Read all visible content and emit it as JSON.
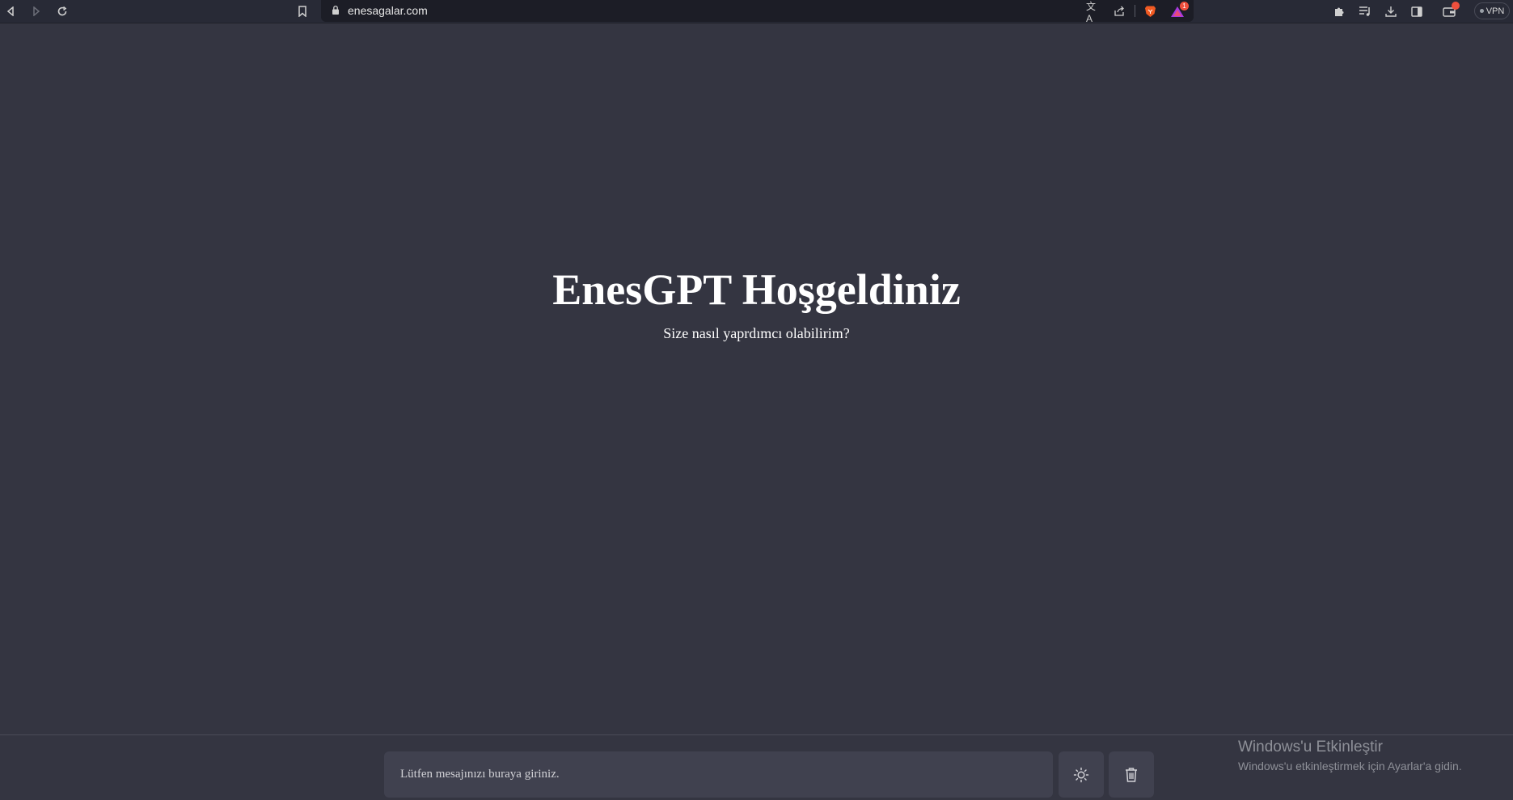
{
  "browser": {
    "url": "enesagalar.com",
    "vpn_label": "VPN",
    "alert_badge_count": "1"
  },
  "hero": {
    "title": "EnesGPT Hoşgeldiniz",
    "subtitle": "Size nasıl yaprdımcı olabilirim?"
  },
  "chat": {
    "input_placeholder": "Lütfen mesajınızı buraya giriniz."
  },
  "watermark": {
    "title": "Windows'u Etkinleştir",
    "subtitle": "Windows'u etkinleştirmek için Ayarlar'a gidin."
  },
  "colors": {
    "page_background": "#343541",
    "input_background": "#40414f",
    "browser_bar": "#282a36"
  }
}
